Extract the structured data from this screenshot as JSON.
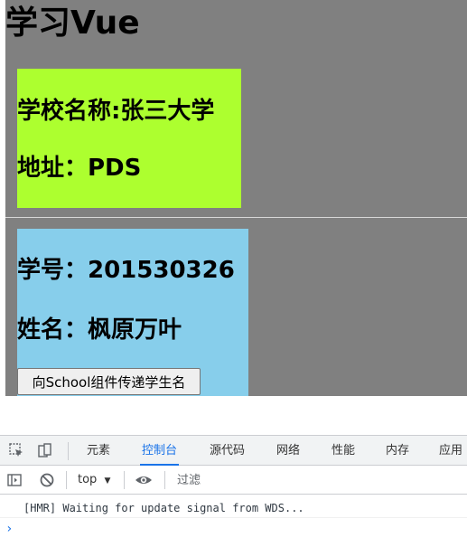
{
  "app": {
    "title": "学习Vue",
    "school": {
      "name_line": "学校名称:张三大学",
      "address_line": "地址：PDS"
    },
    "student": {
      "id_line": "学号：201530326",
      "name_line": "姓名：枫原万叶"
    },
    "send_button_label": "向School组件传递学生名"
  },
  "colors": {
    "app_background": "#808080",
    "school_box": "#adff2f",
    "student_box": "#87ceeb",
    "devtools_accent": "#1a73e8"
  },
  "devtools": {
    "tabs": [
      "元素",
      "控制台",
      "源代码",
      "网络",
      "性能",
      "内存",
      "应用"
    ],
    "active_tab": "控制台",
    "context": "top",
    "filter_placeholder": "过滤",
    "console_messages": [
      "[HMR] Waiting for update signal from WDS..."
    ]
  },
  "icons": {
    "inspect": "inspect-element-icon",
    "device": "device-toolbar-icon",
    "sidebar": "console-sidebar-icon",
    "clear": "clear-console-icon",
    "dropdown": "chevron-down-icon",
    "eye": "live-expression-eye-icon",
    "prompt": "console-prompt-icon"
  }
}
